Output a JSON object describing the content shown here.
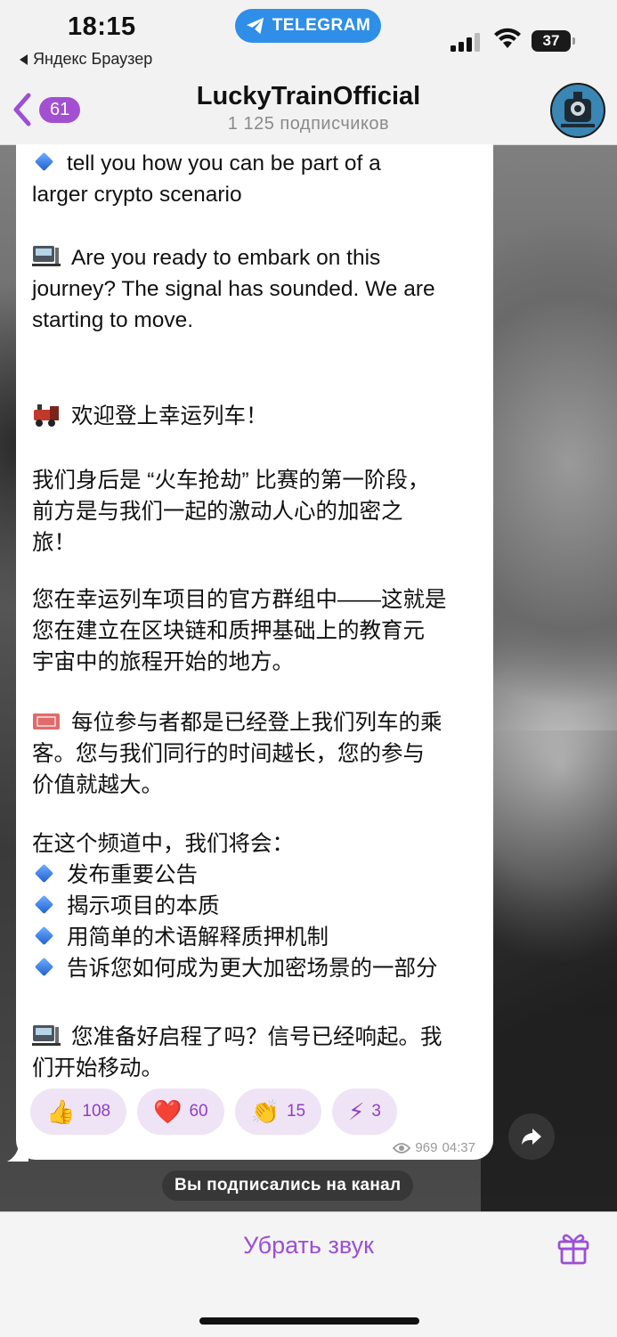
{
  "status_bar": {
    "time": "18:15",
    "back_app": "Яндекс Браузер",
    "pill_label": "TELEGRAM",
    "battery": "37"
  },
  "header": {
    "back_count": "61",
    "title": "LuckyTrainOfficial",
    "subtitle": "1 125 подписчиков"
  },
  "message": {
    "lines": [
      "tell you how you can be part of a",
      "larger crypto scenario",
      "Are you ready to embark on this",
      "journey? The signal has sounded. We are",
      "starting to move.",
      "欢迎登上幸运列车！",
      "我们身后是 “火车抢劫” 比赛的第一阶段，",
      "前方是与我们一起的激动人心的加密之",
      "旅！",
      "您在幸运列车项目的官方群组中——这就是",
      "您在建立在区块链和质押基础上的教育元",
      "宇宙中的旅程开始的地方。",
      "每位参与者都是已经登上我们列车的乘",
      "客。您与我们同行的时间越长，您的参与",
      "价值就越大。",
      "在这个频道中，我们将会：",
      "发布重要公告",
      "揭示项目的本质",
      "用简单的术语解释质押机制",
      "告诉您如何成为更大加密场景的一部分",
      "您准备好启程了吗？信号已经响起。我",
      "们开始移动。"
    ],
    "reactions": [
      {
        "emoji": "👍",
        "icon": "thumbs-up-icon",
        "count": "108"
      },
      {
        "emoji": "❤️",
        "icon": "heart-icon",
        "count": "60"
      },
      {
        "emoji": "👏",
        "icon": "clapping-hands-icon",
        "count": "15"
      },
      {
        "emoji": "⚡",
        "icon": "lightning-icon",
        "count": "3"
      }
    ],
    "views": "969",
    "time": "04:37"
  },
  "service_message": "Вы подписались на канал",
  "bottom_bar": {
    "mute_label": "Убрать звук"
  },
  "colors": {
    "accent": "#9b4fd6",
    "badge": "#a24fd1",
    "reaction_bg": "#efe4f6",
    "pill": "#2f8ee8"
  }
}
